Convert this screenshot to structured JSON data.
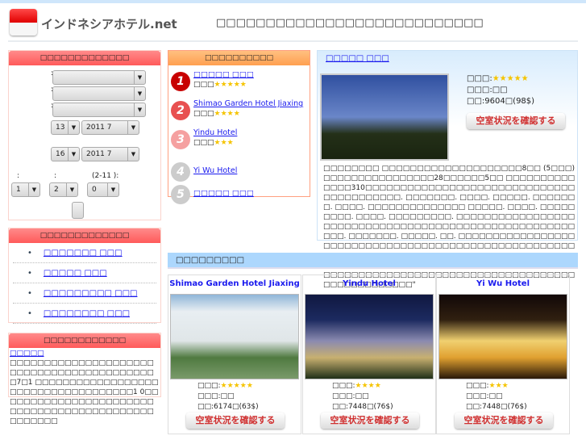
{
  "header": {
    "site_name": "インドネシアホテル.net",
    "tagline": "□□□□□□□□□□□□□□□□□□□□□□□□□□□"
  },
  "search": {
    "title": "□□□□□□□□□□□□□",
    "checkin_day": "13",
    "checkin_month": "2011 7",
    "checkout_day": "16",
    "checkout_month": "2011 7",
    "rooms_label": ":",
    "adults_label": ":",
    "children_label": "(2-11 ):",
    "rooms": "1",
    "adults": "2",
    "children": "0"
  },
  "ranking": {
    "title": "□□□□□□□□□□",
    "items": [
      {
        "num": "1",
        "name": "□□□□□ □□□",
        "grade": "□□□",
        "stars": "★★★★★",
        "color": "#c80000"
      },
      {
        "num": "2",
        "name": "Shimao Garden Hotel Jiaxing",
        "grade": "□□□",
        "stars": "★★★★",
        "color": "#e85050"
      },
      {
        "num": "3",
        "name": "Yindu Hotel",
        "grade": "□□□",
        "stars": "★★★",
        "color": "#f5a0a0"
      },
      {
        "num": "4",
        "name": "Yi Wu Hotel",
        "grade": "",
        "stars": "",
        "color": "#cccccc"
      },
      {
        "num": "5",
        "name": "□□□□□ □□□",
        "grade": "",
        "stars": "",
        "color": "#cccccc"
      }
    ]
  },
  "featured": {
    "name": "□□□□□ □□□",
    "grade_label": "□□□:",
    "stars": "★★★★★",
    "area": "□□□:□□",
    "price": "□□:9604□(98$)",
    "button": "空室状況を確認する",
    "description": "□□□□□□□□ □□□□□□□□□□□□□□□□□□□□8□□ (5□□□)□□□□□□□□□□□□□□□□28□□□□□□5□□ □□□□□□□□□□□□□□310□□□□□□□□□□□□□□□□□□□□□□□□□□□□□□□□□□□□□□□□□. □□□□□□□. □□□□. □□□□□. □□□□□□□. □□□□. □□□□□□□□□□□□□□ □□□□□. □□□□. □□□□□□□□□. □□□□. □□□□□□□□□. □□□□□□□□□□□□□□□□□□□□□□□□□□□□□□□□□□□□□□□□□□□□□□□□□□□□□□□□. □□□□□□□. □□□□□. □□. □□□□□□□□□□□□□□□□□□□□□□□□□□□□□□□□□□□□□□□□□□□□□□□□□□□□□□□□□□□□□□□□□□□□□□□□□□□□□□□□□□□□□□□□□□□□□□□□□□□□□□□□□□□□□□□□□□□ □□□□□□□□□□□□□□□□□□□□□□□□□□□□□□□□□□□□□□□□□□□□□□□□□□□□□□□□□□□\""
  },
  "areas": {
    "title": "□□□□□□□□□□□□□",
    "items": [
      "□□□□□□□ □□□",
      "□□□□□ □□□",
      "□□□□□□□□□ □□□",
      "□□□□□□□□ □□□"
    ]
  },
  "news": {
    "title": "□□□□□□□□□□□□",
    "link": "□□□□□",
    "body": "□□□□□□□□□□□□□□□□□□□□□□□□□□□□□□□□□□□□□□□□□□□7□1 □□□□□□□□□□□□□□□□□□□□□□□□□□□□□□□□□□□□1 0□□□□□□□□□□□□□□□□□□□□□□□□□□□□□□□□□□□□□□□□□□□□□□□□□□□"
  },
  "recommended": {
    "title": "□□□□□□□□□",
    "cards": [
      {
        "name": "Shimao Garden Hotel Jiaxing",
        "grade_label": "□□□:",
        "stars": "★★★★★",
        "area": "□□□:□□",
        "price": "□□:6174□(63$)",
        "button": "空室状況を確認する"
      },
      {
        "name": "Yindu Hotel",
        "grade_label": "□□□:",
        "stars": "★★★★",
        "area": "□□□:□□",
        "price": "□□:7448□(76$)",
        "button": "空室状況を確認する"
      },
      {
        "name": "Yi Wu Hotel",
        "grade_label": "□□□:",
        "stars": "★★★",
        "area": "□□□:□□",
        "price": "□□:7448□(76$)",
        "button": "空室状況を確認する"
      }
    ]
  }
}
